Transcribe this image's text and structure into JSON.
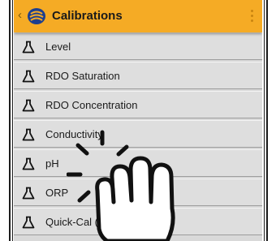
{
  "header": {
    "title": "Calibrations",
    "back_icon": "chevron-left-icon",
    "logo_icon": "app-logo-icon",
    "menu_icon": "more-vertical-icon",
    "background": "#f5ab25"
  },
  "list": {
    "items": [
      {
        "label": "Level",
        "icon": "flask-icon"
      },
      {
        "label": "RDO Saturation",
        "icon": "flask-icon"
      },
      {
        "label": "RDO Concentration",
        "icon": "flask-icon"
      },
      {
        "label": "Conductivity",
        "icon": "flask-icon"
      },
      {
        "label": "pH",
        "icon": "flask-icon"
      },
      {
        "label": "ORP",
        "icon": "flask-icon"
      },
      {
        "label": "Quick-Cal (multi-sensor)",
        "icon": "flask-icon"
      }
    ]
  },
  "overlay": {
    "icon": "tap-hand-icon"
  }
}
